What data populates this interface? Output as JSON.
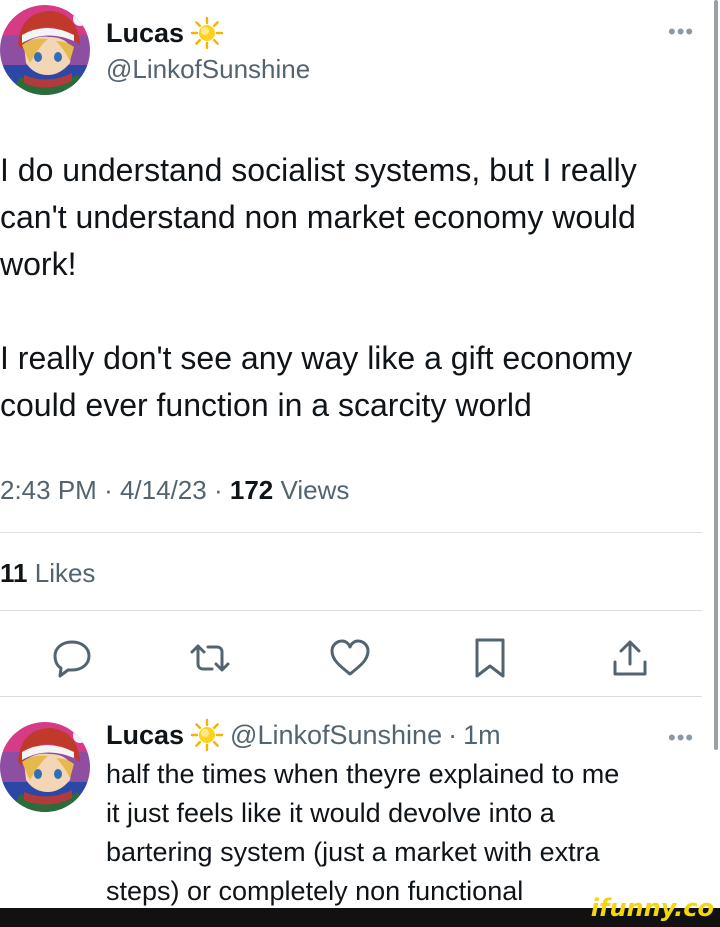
{
  "tweet": {
    "author_name": "Lucas",
    "name_emoji": "sun-icon",
    "handle": "@LinkofSunshine",
    "text": "I do understand socialist systems, but I really\ncan't understand non market economy would\nwork!\n\nI really don't see any way like a gift economy\ncould ever function in a scarcity world",
    "time": "2:43 PM",
    "date": "4/14/23",
    "separator": "·",
    "views_count": "172",
    "views_label": "Views",
    "likes_count": "11",
    "likes_label": "Likes"
  },
  "actions": [
    {
      "name": "reply-icon"
    },
    {
      "name": "retweet-icon"
    },
    {
      "name": "like-icon"
    },
    {
      "name": "bookmark-icon"
    },
    {
      "name": "share-icon"
    }
  ],
  "reply": {
    "author_name": "Lucas",
    "name_emoji": "sun-icon",
    "handle": "@LinkofSunshine",
    "separator": "·",
    "time": "1m",
    "text": "half the times when theyre explained to me\nit just feels like it would devolve into a\nbartering system (just a market with extra\nsteps) or completely non functional"
  },
  "watermark": "ifunny.co",
  "colors": {
    "text": "#0f1419",
    "secondary": "#536471",
    "divider": "#d9dee2",
    "watermark": "#f5d60a"
  }
}
